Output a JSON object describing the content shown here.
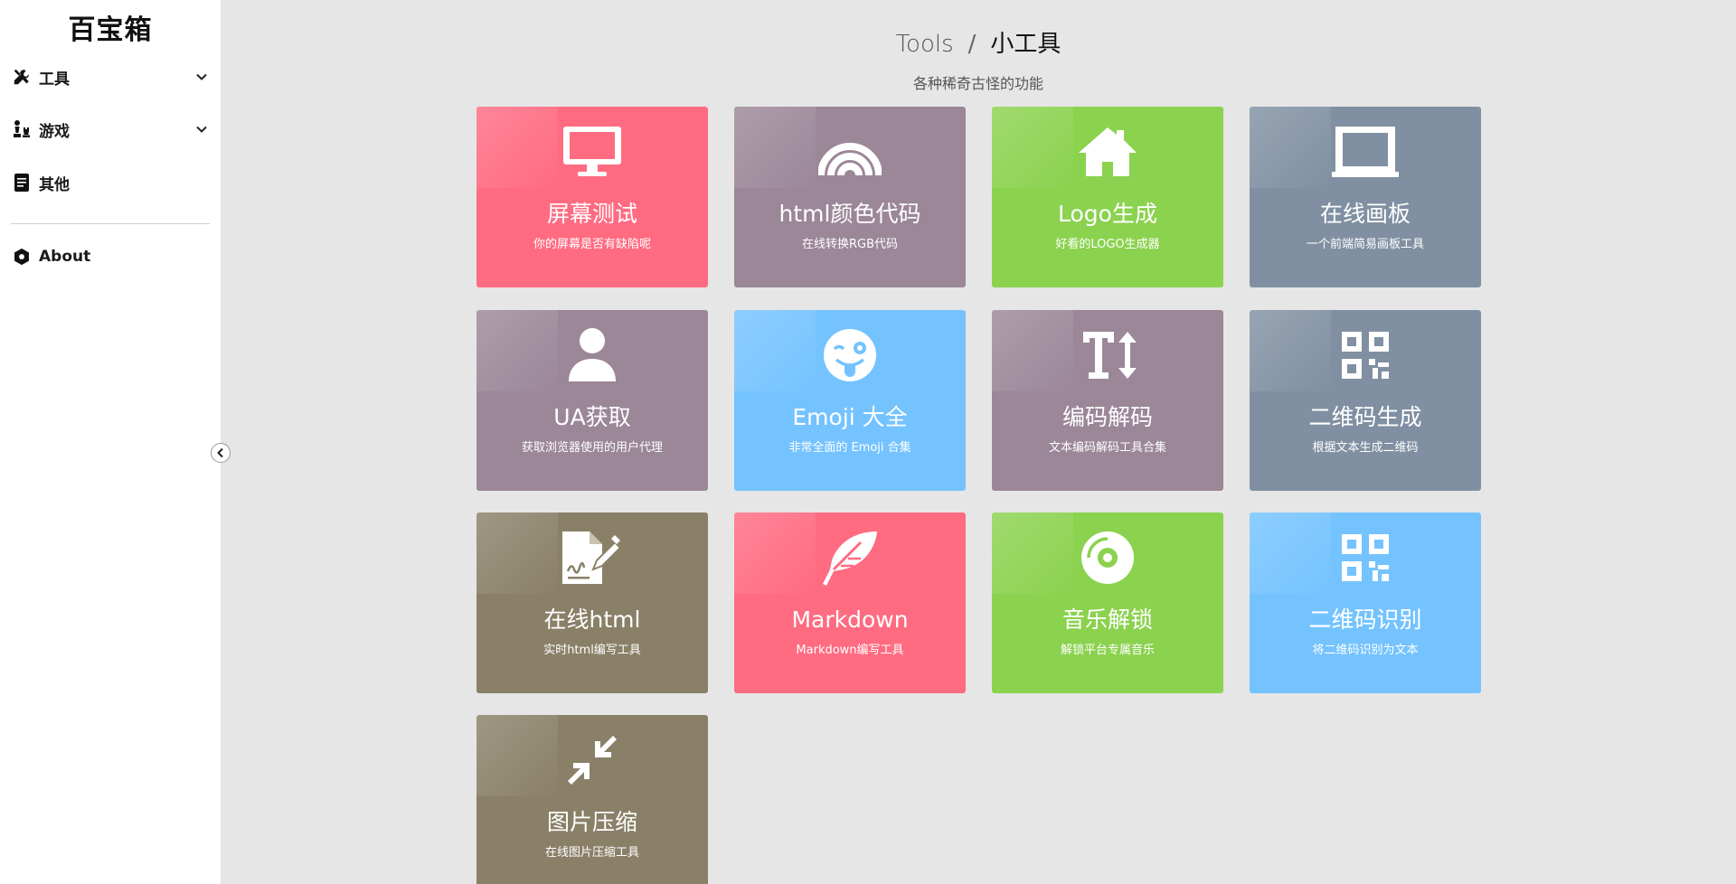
{
  "sidebar": {
    "brand": "百宝箱",
    "items": [
      {
        "label": "工具",
        "icon": "tools-icon",
        "expandable": true
      },
      {
        "label": "游戏",
        "icon": "chess-icon",
        "expandable": true
      },
      {
        "label": "其他",
        "icon": "book-icon",
        "expandable": false
      }
    ],
    "about_label": "About"
  },
  "header": {
    "crumb_root": "Tools",
    "crumb_sep": "/",
    "crumb_current": "小工具",
    "subtitle": "各种稀奇古怪的功能"
  },
  "cards": [
    {
      "title": "屏幕测试",
      "desc": "你的屏幕是否有缺陷呢",
      "color": "#ff6b81",
      "icon": "monitor-icon"
    },
    {
      "title": "html颜色代码",
      "desc": "在线转换RGB代码",
      "color": "#9b8798",
      "icon": "rainbow-icon"
    },
    {
      "title": "Logo生成",
      "desc": "好看的LOGO生成器",
      "color": "#8bd24f",
      "icon": "home-icon"
    },
    {
      "title": "在线画板",
      "desc": "一个前端简易画板工具",
      "color": "#8090a2",
      "icon": "chalkboard-icon"
    },
    {
      "title": "UA获取",
      "desc": "获取浏览器使用的用户代理",
      "color": "#9b8798",
      "icon": "user-icon"
    },
    {
      "title": "Emoji 大全",
      "desc": "非常全面的 Emoji 合集",
      "color": "#74c3ff",
      "icon": "wink-tongue-icon"
    },
    {
      "title": "编码解码",
      "desc": "文本编码解码工具合集",
      "color": "#9b8798",
      "icon": "text-height-icon"
    },
    {
      "title": "二维码生成",
      "desc": "根据文本生成二维码",
      "color": "#8090a2",
      "icon": "qrcode-icon"
    },
    {
      "title": "在线html",
      "desc": "实时html编写工具",
      "color": "#8a8068",
      "icon": "file-signature-icon"
    },
    {
      "title": "Markdown",
      "desc": "Markdown编写工具",
      "color": "#ff6b81",
      "icon": "feather-icon"
    },
    {
      "title": "音乐解锁",
      "desc": "解锁平台专属音乐",
      "color": "#8bd24f",
      "icon": "compact-disc-icon"
    },
    {
      "title": "二维码识别",
      "desc": "将二维码识别为文本",
      "color": "#74c3ff",
      "icon": "qrcode-icon"
    },
    {
      "title": "图片压缩",
      "desc": "在线图片压缩工具",
      "color": "#8a8068",
      "icon": "compress-arrows-icon"
    }
  ]
}
